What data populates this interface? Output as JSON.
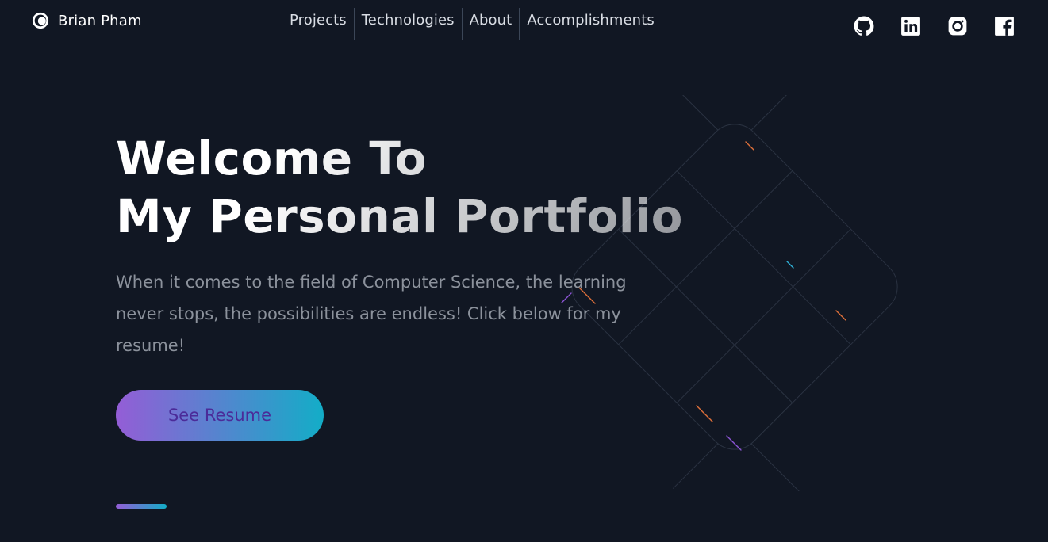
{
  "brand": {
    "name": "Brian Pham",
    "logo_icon": "circle-logo-icon"
  },
  "nav": {
    "items": [
      {
        "label": "Projects"
      },
      {
        "label": "Technologies"
      },
      {
        "label": "About"
      },
      {
        "label": "Accomplishments"
      }
    ]
  },
  "socials": [
    {
      "icon": "github-icon"
    },
    {
      "icon": "linkedin-icon"
    },
    {
      "icon": "instagram-icon"
    },
    {
      "icon": "facebook-icon"
    }
  ],
  "hero": {
    "title_line1": "Welcome To",
    "title_line2": "My Personal Portfolio",
    "description": "When it comes to the field of Computer Science, the learning never stops, the possibilities are endless! Click below for my resume!",
    "button_label": "See Resume"
  },
  "colors": {
    "background": "#111723",
    "gradient_start": "#945dd6",
    "gradient_mid": "#6978d1",
    "gradient_end": "#13adc7",
    "button_text": "#4b2b99",
    "body_text": "#8c929c"
  }
}
